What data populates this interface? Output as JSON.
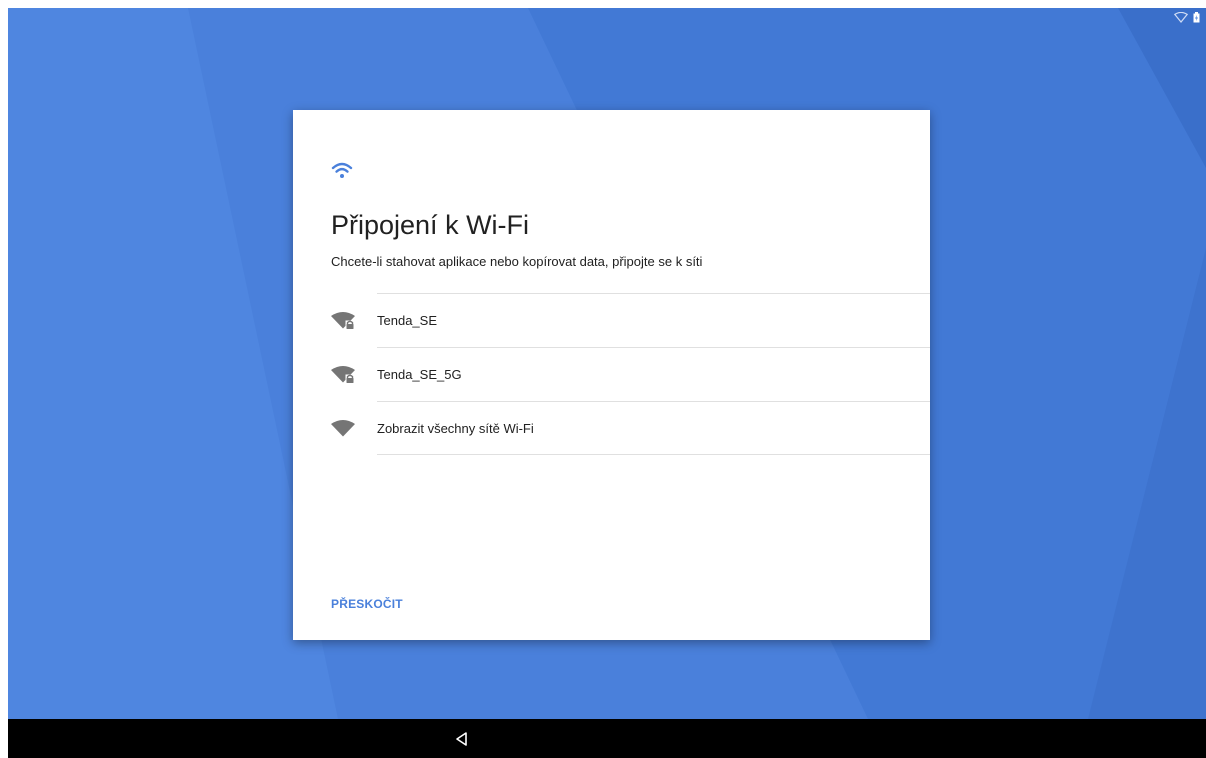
{
  "colors": {
    "wallpaper": "#4a80db",
    "accent": "#4a80db",
    "wifi_icon_gray": "#757575",
    "navbar": "#000000"
  },
  "status_bar": {
    "icons": [
      "wifi-outline-icon",
      "battery-charging-icon"
    ]
  },
  "setup": {
    "header_icon": "wifi-icon",
    "title": "Připojení k Wi-Fi",
    "subtitle": "Chcete-li stahovat aplikace nebo kopírovat data, připojte se k síti",
    "networks": [
      {
        "name": "Tenda_SE",
        "icon": "wifi-locked-icon"
      },
      {
        "name": "Tenda_SE_5G",
        "icon": "wifi-locked-icon"
      },
      {
        "name": "Zobrazit všechny sítě Wi-Fi",
        "icon": "wifi-icon"
      }
    ],
    "skip_label": "PŘESKOČIT"
  },
  "navigation_bar": {
    "buttons": [
      "back-icon"
    ]
  }
}
